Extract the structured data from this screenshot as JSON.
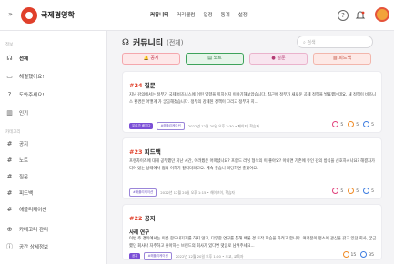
{
  "app": {
    "brand": "국제경영학",
    "collapse_glyph": "»",
    "help_glyph": "?"
  },
  "topnav": [
    "커뮤니티",
    "커리큘럼",
    "일정",
    "통계",
    "설정"
  ],
  "sidebar": {
    "group1_label": "정보",
    "group1": [
      {
        "icon": "community-icon",
        "glyph": "☊",
        "label": "전체",
        "active": true
      },
      {
        "icon": "chat-bubble-icon",
        "glyph": "▭",
        "label": "해결했어요!",
        "active": false
      },
      {
        "icon": "question-bubble-icon",
        "glyph": "?",
        "label": "도와주세요!",
        "active": false
      },
      {
        "icon": "chart-icon",
        "glyph": "▥",
        "label": "인기",
        "active": false
      }
    ],
    "group2_label": "카테고리",
    "group2": [
      {
        "label": "공지"
      },
      {
        "label": "노트"
      },
      {
        "label": "질문"
      },
      {
        "label": "피드백"
      },
      {
        "label": "해플리케이션"
      }
    ],
    "bottom": [
      {
        "icon": "add-category-icon",
        "glyph": "⊕",
        "label": "카테고리 관리"
      },
      {
        "icon": "info-icon",
        "glyph": "ⓘ",
        "label": "공간 상세정보"
      }
    ]
  },
  "main": {
    "title": "커뮤니티",
    "title_sub": "(전체)",
    "search_placeholder": "검색",
    "filters": [
      "공지",
      "노트",
      "질문",
      "피드백"
    ]
  },
  "posts": [
    {
      "num": "#24",
      "category": "질문",
      "subtitle": "",
      "body": "지난 강의에서는 정부가 국제 비즈니스에 어떤 영향을 끼치는지 이야기해보았습니다. 최근에 정부가 새로운 공제 정책을 발표했는데요, 새 정책이 비즈니스 환경은 어떻게 가 궁금해졌습니다. 정부의 강제된 정책이 그리고 정부가 지...",
      "badges": [
        "우리가 배우다",
        "#해플리케이션"
      ],
      "meta": "2022년 12월 20일 오후 2:30 • 페이지, 학습자",
      "stats": [
        "5",
        "5",
        "5"
      ]
    },
    {
      "num": "#23",
      "category": "피드백",
      "subtitle": "",
      "body": "프랜차이즈에 대해 공부했던 지난 시간, 어려웠은 어떠셨나요? 프랍드 러닝 형식의 이 좋아요? 아니면 기존에 유인 강의 방식을 선호하시나요? 해결자가 되어 있는 상태에서 협의 이해가 잘되더라고요. 계속 좋습니 리딩하면 좋겠어요.",
      "badges": [
        "#해플리케이션"
      ],
      "meta": "2022년 12월 20일 오후 1:15 • 해이브이, 학습자",
      "stats": [
        "5",
        "5",
        "5"
      ]
    },
    {
      "num": "#22",
      "category": "공지",
      "subtitle": "사례 연구",
      "body": "이번 주 경의에서는 이론 한도내기거를 하지 않고, 다양한 연구를 통해 배울 경 토작 학습을 하려고 합니다. 여러분이 평소에 관심을 갖고 있던 회사, 궁금했던 회사나 자주하고 좋아하는 브랜드의 회사가 있다면 댓글로 남겨주세요...",
      "badges": [
        "공지",
        "#해플리케이션"
      ],
      "meta": "2022년 12월 20일 오후 1:00 • 조교, 교육자",
      "stats": [
        "15",
        "35"
      ]
    }
  ],
  "colors": {
    "accent": "#e0402b",
    "purple": "#7b4fd6"
  }
}
